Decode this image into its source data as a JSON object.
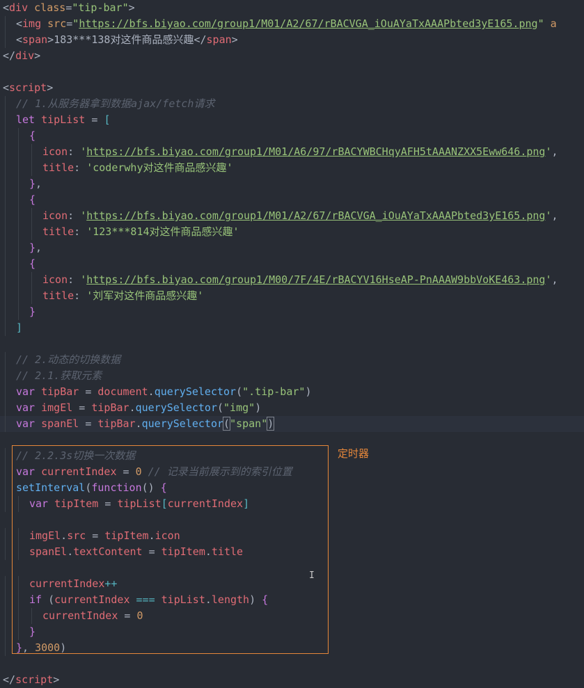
{
  "annotation": {
    "label": "定时器"
  },
  "lines": [
    {
      "indent": 0,
      "tokens": [
        [
          "punc",
          "<"
        ],
        [
          "tag",
          "div"
        ],
        [
          "punc",
          " "
        ],
        [
          "attr",
          "class"
        ],
        [
          "punc",
          "="
        ],
        [
          "str",
          "\"tip-bar\""
        ],
        [
          "punc",
          ">"
        ]
      ]
    },
    {
      "indent": 1,
      "tokens": [
        [
          "punc",
          "<"
        ],
        [
          "tag",
          "img"
        ],
        [
          "punc",
          " "
        ],
        [
          "attr",
          "src"
        ],
        [
          "punc",
          "="
        ],
        [
          "str",
          "\""
        ],
        [
          "url",
          "https://bfs.biyao.com/group1/M01/A2/67/rBACVGA_iOuAYaTxAAAPbted3yE165.png"
        ],
        [
          "str",
          "\""
        ],
        [
          "punc",
          " "
        ],
        [
          "attr",
          "a"
        ]
      ]
    },
    {
      "indent": 1,
      "tokens": [
        [
          "punc",
          "<"
        ],
        [
          "tag",
          "span"
        ],
        [
          "punc",
          ">"
        ],
        [
          "text",
          "183***138对这件商品感兴趣"
        ],
        [
          "punc",
          "</"
        ],
        [
          "tag",
          "span"
        ],
        [
          "punc",
          ">"
        ]
      ]
    },
    {
      "indent": 0,
      "tokens": [
        [
          "punc",
          "</"
        ],
        [
          "tag",
          "div"
        ],
        [
          "punc",
          ">"
        ]
      ]
    },
    {
      "indent": 0,
      "tokens": []
    },
    {
      "indent": 0,
      "tokens": [
        [
          "punc",
          "<"
        ],
        [
          "tag",
          "script"
        ],
        [
          "punc",
          ">"
        ]
      ]
    },
    {
      "indent": 1,
      "tokens": [
        [
          "cmt",
          "// 1.从服务器拿到数据ajax/fetch请求"
        ]
      ]
    },
    {
      "indent": 1,
      "tokens": [
        [
          "kw",
          "let"
        ],
        [
          "punc",
          " "
        ],
        [
          "var",
          "tipList"
        ],
        [
          "punc",
          " = "
        ],
        [
          "brk",
          "["
        ]
      ]
    },
    {
      "indent": 2,
      "tokens": [
        [
          "kw",
          "{"
        ]
      ]
    },
    {
      "indent": 3,
      "tokens": [
        [
          "var",
          "icon"
        ],
        [
          "punc",
          ": "
        ],
        [
          "str",
          "'"
        ],
        [
          "url",
          "https://bfs.biyao.com/group1/M01/A6/97/rBACYWBCHqyAFH5tAAANZXX5Eww646.png"
        ],
        [
          "str",
          "'"
        ],
        [
          "punc",
          ","
        ]
      ]
    },
    {
      "indent": 3,
      "tokens": [
        [
          "var",
          "title"
        ],
        [
          "punc",
          ": "
        ],
        [
          "str",
          "'coderwhy对这件商品感兴趣'"
        ]
      ]
    },
    {
      "indent": 2,
      "tokens": [
        [
          "kw",
          "}"
        ],
        [
          "punc",
          ","
        ]
      ]
    },
    {
      "indent": 2,
      "tokens": [
        [
          "kw",
          "{"
        ]
      ]
    },
    {
      "indent": 3,
      "tokens": [
        [
          "var",
          "icon"
        ],
        [
          "punc",
          ": "
        ],
        [
          "str",
          "'"
        ],
        [
          "url",
          "https://bfs.biyao.com/group1/M01/A2/67/rBACVGA_iOuAYaTxAAAPbted3yE165.png"
        ],
        [
          "str",
          "'"
        ],
        [
          "punc",
          ","
        ]
      ]
    },
    {
      "indent": 3,
      "tokens": [
        [
          "var",
          "title"
        ],
        [
          "punc",
          ": "
        ],
        [
          "str",
          "'123***814对这件商品感兴趣'"
        ]
      ]
    },
    {
      "indent": 2,
      "tokens": [
        [
          "kw",
          "}"
        ],
        [
          "punc",
          ","
        ]
      ]
    },
    {
      "indent": 2,
      "tokens": [
        [
          "kw",
          "{"
        ]
      ]
    },
    {
      "indent": 3,
      "tokens": [
        [
          "var",
          "icon"
        ],
        [
          "punc",
          ": "
        ],
        [
          "str",
          "'"
        ],
        [
          "url",
          "https://bfs.biyao.com/group1/M00/7F/4E/rBACYV16HseAP-PnAAAW9bbVoKE463.png"
        ],
        [
          "str",
          "'"
        ],
        [
          "punc",
          ","
        ]
      ]
    },
    {
      "indent": 3,
      "tokens": [
        [
          "var",
          "title"
        ],
        [
          "punc",
          ": "
        ],
        [
          "str",
          "'刘军对这件商品感兴趣'"
        ]
      ]
    },
    {
      "indent": 2,
      "tokens": [
        [
          "kw",
          "}"
        ]
      ]
    },
    {
      "indent": 1,
      "tokens": [
        [
          "brk",
          "]"
        ]
      ]
    },
    {
      "indent": 0,
      "tokens": []
    },
    {
      "indent": 1,
      "tokens": [
        [
          "cmt",
          "// 2.动态的切换数据"
        ]
      ]
    },
    {
      "indent": 1,
      "tokens": [
        [
          "cmt",
          "// 2.1.获取元素"
        ]
      ]
    },
    {
      "indent": 1,
      "tokens": [
        [
          "kw",
          "var"
        ],
        [
          "punc",
          " "
        ],
        [
          "var",
          "tipBar"
        ],
        [
          "punc",
          " = "
        ],
        [
          "var",
          "document"
        ],
        [
          "punc",
          "."
        ],
        [
          "fn",
          "querySelector"
        ],
        [
          "punc",
          "("
        ],
        [
          "str",
          "\".tip-bar\""
        ],
        [
          "punc",
          ")"
        ]
      ]
    },
    {
      "indent": 1,
      "tokens": [
        [
          "kw",
          "var"
        ],
        [
          "punc",
          " "
        ],
        [
          "var",
          "imgEl"
        ],
        [
          "punc",
          " = "
        ],
        [
          "var",
          "tipBar"
        ],
        [
          "punc",
          "."
        ],
        [
          "fn",
          "querySelector"
        ],
        [
          "punc",
          "("
        ],
        [
          "str",
          "\"img\""
        ],
        [
          "punc",
          ")"
        ]
      ]
    },
    {
      "indent": 1,
      "cur": true,
      "tokens": [
        [
          "kw",
          "var"
        ],
        [
          "punc",
          " "
        ],
        [
          "var",
          "spanEl"
        ],
        [
          "punc",
          " = "
        ],
        [
          "var",
          "tipBar"
        ],
        [
          "punc",
          "."
        ],
        [
          "fn",
          "querySelector"
        ],
        [
          "match",
          "("
        ],
        [
          "str",
          "\"span\""
        ],
        [
          "match",
          ")"
        ]
      ]
    },
    {
      "indent": 0,
      "tokens": []
    },
    {
      "indent": 1,
      "tokens": [
        [
          "cmt",
          "// 2.2.3s切换一次数据"
        ]
      ]
    },
    {
      "indent": 1,
      "tokens": [
        [
          "kw",
          "var"
        ],
        [
          "punc",
          " "
        ],
        [
          "var",
          "currentIndex"
        ],
        [
          "punc",
          " = "
        ],
        [
          "num",
          "0"
        ],
        [
          "punc",
          " "
        ],
        [
          "cmt",
          "// 记录当前展示到的索引位置"
        ]
      ]
    },
    {
      "indent": 1,
      "tokens": [
        [
          "fn",
          "setInterval"
        ],
        [
          "punc",
          "("
        ],
        [
          "kw",
          "function"
        ],
        [
          "punc",
          "() "
        ],
        [
          "kw",
          "{"
        ]
      ]
    },
    {
      "indent": 2,
      "tokens": [
        [
          "kw",
          "var"
        ],
        [
          "punc",
          " "
        ],
        [
          "var",
          "tipItem"
        ],
        [
          "punc",
          " = "
        ],
        [
          "var",
          "tipList"
        ],
        [
          "brk",
          "["
        ],
        [
          "var",
          "currentIndex"
        ],
        [
          "brk",
          "]"
        ]
      ]
    },
    {
      "indent": 0,
      "tokens": []
    },
    {
      "indent": 2,
      "tokens": [
        [
          "var",
          "imgEl"
        ],
        [
          "punc",
          "."
        ],
        [
          "var",
          "src"
        ],
        [
          "punc",
          " = "
        ],
        [
          "var",
          "tipItem"
        ],
        [
          "punc",
          "."
        ],
        [
          "var",
          "icon"
        ]
      ]
    },
    {
      "indent": 2,
      "tokens": [
        [
          "var",
          "spanEl"
        ],
        [
          "punc",
          "."
        ],
        [
          "var",
          "textContent"
        ],
        [
          "punc",
          " = "
        ],
        [
          "var",
          "tipItem"
        ],
        [
          "punc",
          "."
        ],
        [
          "var",
          "title"
        ]
      ]
    },
    {
      "indent": 0,
      "tokens": []
    },
    {
      "indent": 2,
      "tokens": [
        [
          "var",
          "currentIndex"
        ],
        [
          "prop",
          "++"
        ]
      ]
    },
    {
      "indent": 2,
      "tokens": [
        [
          "kw",
          "if"
        ],
        [
          "punc",
          " ("
        ],
        [
          "var",
          "currentIndex"
        ],
        [
          "punc",
          " "
        ],
        [
          "prop",
          "==="
        ],
        [
          "punc",
          " "
        ],
        [
          "var",
          "tipList"
        ],
        [
          "punc",
          "."
        ],
        [
          "var",
          "length"
        ],
        [
          "punc",
          ") "
        ],
        [
          "kw",
          "{"
        ]
      ]
    },
    {
      "indent": 3,
      "tokens": [
        [
          "var",
          "currentIndex"
        ],
        [
          "punc",
          " = "
        ],
        [
          "num",
          "0"
        ]
      ]
    },
    {
      "indent": 2,
      "tokens": [
        [
          "kw",
          "}"
        ]
      ]
    },
    {
      "indent": 1,
      "tokens": [
        [
          "kw",
          "}"
        ],
        [
          "punc",
          ", "
        ],
        [
          "num",
          "3000"
        ],
        [
          "punc",
          ")"
        ]
      ]
    },
    {
      "indent": 0,
      "tokens": []
    },
    {
      "indent": 0,
      "tokens": [
        [
          "punc",
          "</"
        ],
        [
          "tag",
          "script"
        ],
        [
          "punc",
          ">"
        ]
      ]
    }
  ]
}
